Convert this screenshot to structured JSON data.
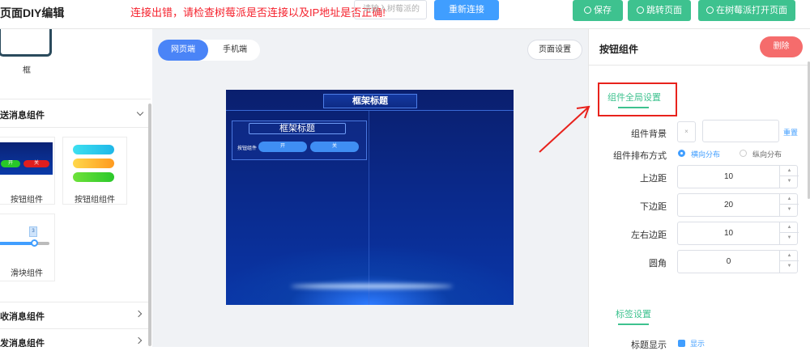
{
  "app": {
    "title": "页面DIY编辑",
    "connection_error": "连接出错，请检查树莓派是否连接以及IP地址是否正确!",
    "ip_input_placeholder": "请输入树莓派的",
    "reconnect_label": "重新连接",
    "save_label": "保存",
    "jump_label": "跳转页面",
    "open_on_pi_label": "在树莓派打开页面",
    "colors": {
      "primary": "#409eff",
      "success": "#3ec28f",
      "danger": "#f56c6c",
      "error_text": "#f5222d"
    }
  },
  "left_panel": {
    "frame_card_label": "框",
    "group_send": "送消息组件",
    "button_card_label": "按钮组件",
    "button_group_card_label": "按钮组组件",
    "on_label": "开",
    "off_label": "关",
    "slider_card_label": "滑块组件",
    "slider_value": "3",
    "group_receive": "收消息组件",
    "group_send2": "发消息组件"
  },
  "center": {
    "tab_web": "网页端",
    "tab_mobile": "手机端",
    "page_settings_label": "页面设置",
    "canvas": {
      "frame_title": "框架标题",
      "inner_frame_title": "框架标题",
      "button_label": "按钮组件",
      "btn_on": "开",
      "btn_off": "关"
    }
  },
  "right_panel": {
    "title": "按钮组件",
    "delete_label": "删除",
    "global_settings_tab": "组件全局设置",
    "bg_label": "组件背景",
    "bg_swatch": "×",
    "reset_label": "重置",
    "layout_label": "组件排布方式",
    "layout_horizontal": "横向分布",
    "layout_vertical": "纵向分布",
    "top_margin_label": "上边距",
    "top_margin": "10",
    "bottom_margin_label": "下边距",
    "bottom_margin": "20",
    "lr_margin_label": "左右边距",
    "lr_margin": "10",
    "radius_label": "圆角",
    "radius": "0",
    "label_settings_tab": "标签设置",
    "title_show_label": "标题显示",
    "show_label": "显示"
  }
}
